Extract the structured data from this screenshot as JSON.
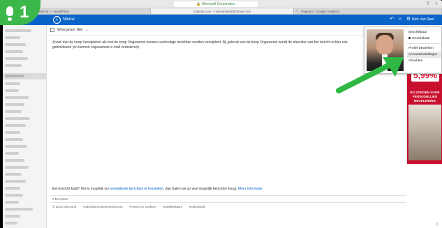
{
  "browser": {
    "address": "Microsoft Corporation",
    "tabs": [
      {
        "label": "Pin Jeneman • Headsets for — WordPress",
        "active": false
      },
      {
        "label": "Outlook.com – nickvanraet@hotmail.com",
        "active": true
      },
      {
        "label": "Pagina's - Google Analytics",
        "active": false
      }
    ]
  },
  "badge": {
    "step": "1"
  },
  "outlook": {
    "back_label": "Nieuw",
    "user_name": "Nick Van Raet",
    "toolbar_label": "Weergeven: Alle",
    "message": "Zowel met de knop Verwijderen als met de knop Ongewenst kunnen overbodige berichten worden verwijderd. Bij gebruik van de knop Ongewenst wordt de afzender van het bericht echter ook geblokkeerd (en kunnen ongewenste e-mail verbeteren).",
    "footer_question": "Een bericht kwijt? Het is mogelijk om",
    "footer_link": "verwijderde berichten te herstellen",
    "footer_after": ", dan halen we zo veel mogelijk berichten terug.",
    "footer_more": "Meer informatie",
    "footer_link1": "3 berichten",
    "footer_links": [
      "© 2013 Microsoft",
      "Gebruiksrechtovereenkomst",
      "Privacy en cookies",
      "Ontwikkelaars",
      "Nederlands"
    ]
  },
  "menu": {
    "items": [
      "Beschikbaar",
      "Onzichtbaar",
      "Profiel bewerken",
      "Accountinstellingen",
      "Afmelden"
    ],
    "selected_item": "Onzichtbaar",
    "highlighted_item": "Accountinstellingen"
  },
  "ad": {
    "percent": "5,99%",
    "text": "BIJ ZORGEN VOOR PERSOONLIJKE BEGELEIDING",
    "info": "▷"
  },
  "colors": {
    "accent": "#0a64c8",
    "badge": "#3cb84a",
    "arrow": "#2fb844",
    "ad": "#c8102e"
  }
}
